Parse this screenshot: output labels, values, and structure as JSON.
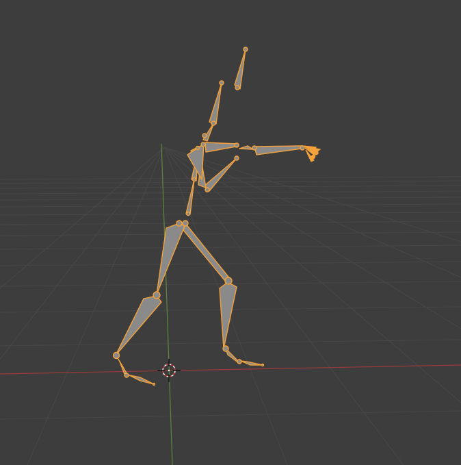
{
  "viewport": {
    "app": "3D Viewport",
    "background_color": "#3d3d3d",
    "grid_color": "#4a4a4a",
    "x_axis_color": "#9b3a3a",
    "y_axis_color": "#5b8a3a",
    "selection_color": "#f5a23a",
    "bone_fill_color": "#8c8c8c",
    "mode": "pose",
    "cursor_icon": "3d-cursor-icon",
    "armature_selected": true
  }
}
